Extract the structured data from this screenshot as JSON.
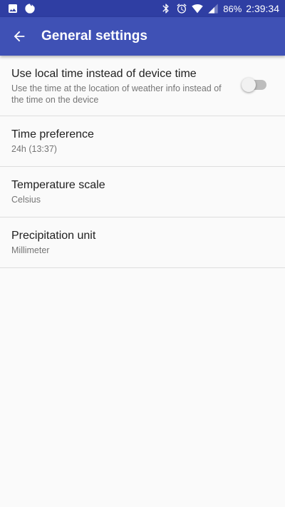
{
  "status_bar": {
    "battery": "86%",
    "time": "2:39:34",
    "left_icons": [
      "image-icon",
      "firefox-icon"
    ],
    "right_icons": [
      "bluetooth-icon",
      "alarm-icon",
      "wifi-icon",
      "signal-icon"
    ]
  },
  "app_bar": {
    "title": "General settings",
    "back_icon": "arrow-left-icon"
  },
  "settings": {
    "local_time": {
      "title": "Use local time instead of device time",
      "summary": "Use the time at the location of weather info instead of the time on the device",
      "enabled": false
    },
    "time_preference": {
      "title": "Time preference",
      "summary": "24h (13:37)"
    },
    "temperature_scale": {
      "title": "Temperature scale",
      "summary": "Celsius"
    },
    "precipitation_unit": {
      "title": "Precipitation unit",
      "summary": "Millimeter"
    }
  },
  "colors": {
    "status_bar": "#2f3ea3",
    "app_bar": "#3f51b5",
    "background": "#fafafa"
  }
}
